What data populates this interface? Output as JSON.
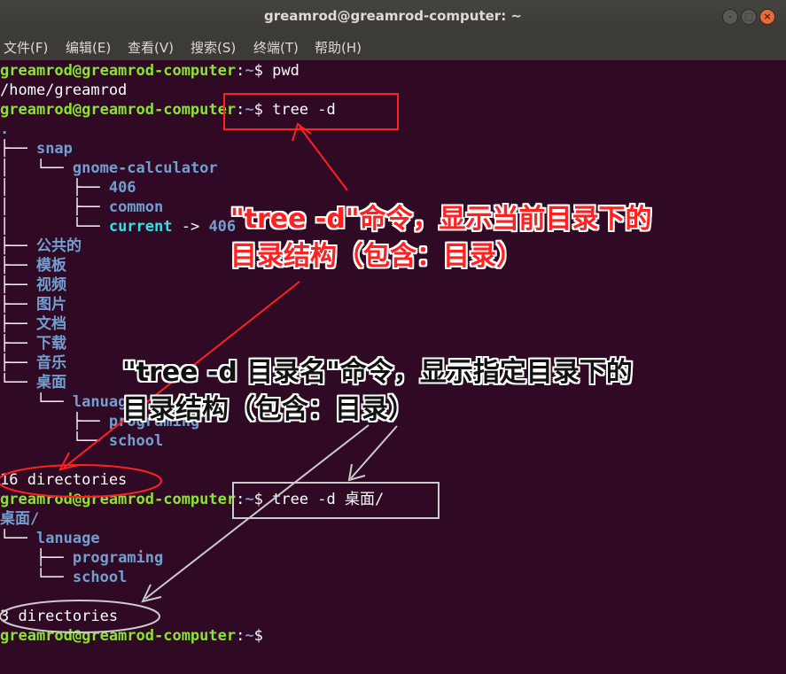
{
  "window": {
    "title": "greamrod@greamrod-computer: ~",
    "buttons": {
      "minimize": "–",
      "maximize": "□",
      "close": "×"
    }
  },
  "menu": [
    "文件(F)",
    "编辑(E)",
    "查看(V)",
    "搜索(S)",
    "终端(T)",
    "帮助(H)"
  ],
  "terminal": {
    "prompt_user": "greamrod@greamrod-computer",
    "prompt_sep": ":",
    "prompt_path": "~",
    "prompt_dollar": "$",
    "lines": {
      "cmd1": " pwd",
      "out_home": "/home/greamrod",
      "cmd2": " tree -d",
      "dot": ".",
      "t_snap_pre": "├── ",
      "t_snap": "snap",
      "t_gc_pre": "│   └── ",
      "t_gc": "gnome-calculator",
      "t_406_pre": "│       ├── ",
      "t_406": "406",
      "t_common_pre": "│       ├── ",
      "t_common": "common",
      "t_current_pre": "│       └── ",
      "t_current": "current",
      "t_current_arrow": " -> ",
      "t_current_target": "406",
      "t_pub_pre": "├── ",
      "t_pub": "公共的",
      "t_tpl_pre": "├── ",
      "t_tpl": "模板",
      "t_vid_pre": "├── ",
      "t_vid": "视频",
      "t_pic_pre": "├── ",
      "t_pic": "图片",
      "t_doc_pre": "├── ",
      "t_doc": "文档",
      "t_dl_pre": "├── ",
      "t_dl": "下载",
      "t_mus_pre": "├── ",
      "t_mus": "音乐",
      "t_desk_pre": "└── ",
      "t_desk": "桌面",
      "t_lan_pre": "    └── ",
      "t_lan": "lanuage",
      "t_prog_pre": "        ├── ",
      "t_prog": "programing",
      "t_sch_pre": "        └── ",
      "t_sch": "school",
      "count1": "16 directories",
      "cmd3": " tree -d 桌面/",
      "desk_root": "桌面/",
      "u_lan_pre": "└── ",
      "u_lan": "lanuage",
      "u_prog_pre": "    ├── ",
      "u_prog": "programing",
      "u_sch_pre": "    └── ",
      "u_sch": "school",
      "count2": "3 directories"
    }
  },
  "annotations": {
    "red_line1": "\"tree -d\"命令，显示当前目录下的",
    "red_line2": "目录结构（包含：目录）",
    "black_line1": "\"tree -d 目录名\"命令，显示指定目录下的",
    "black_line2": "目录结构（包含：目录）"
  },
  "colors": {
    "background": "#300a24",
    "prompt_green": "#8ae234",
    "dir_blue": "#729fcf",
    "link_cyan": "#34e2e2",
    "annotation_red": "#ff2020"
  }
}
